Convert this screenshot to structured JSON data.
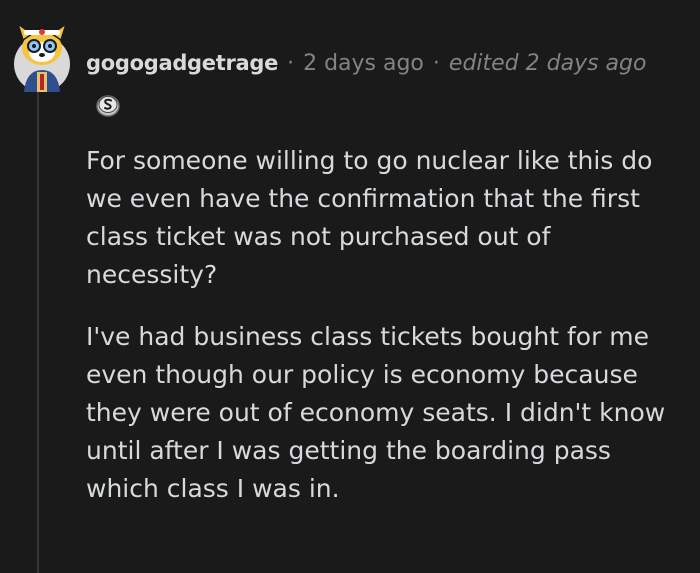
{
  "comment": {
    "username": "gogogadgetrage",
    "separator": "·",
    "timestamp": "2 days ago",
    "edited": "edited 2 days ago",
    "paragraphs": [
      "For someone willing to go nuclear like this do we even have the confirmation that the first class ticket was not purchased out of necessity?",
      "I've had business class tickets bought for me even though our policy is economy because they were out of economy seats. I didn't know until after I was getting the boarding pass which class I was in."
    ]
  },
  "icons": {
    "avatar": "snoo-avatar-icon",
    "flair": "coin-award-icon"
  },
  "colors": {
    "background": "#1a1a1b",
    "text": "#d7dadc",
    "meta": "#818384",
    "thread_line": "#343536"
  }
}
